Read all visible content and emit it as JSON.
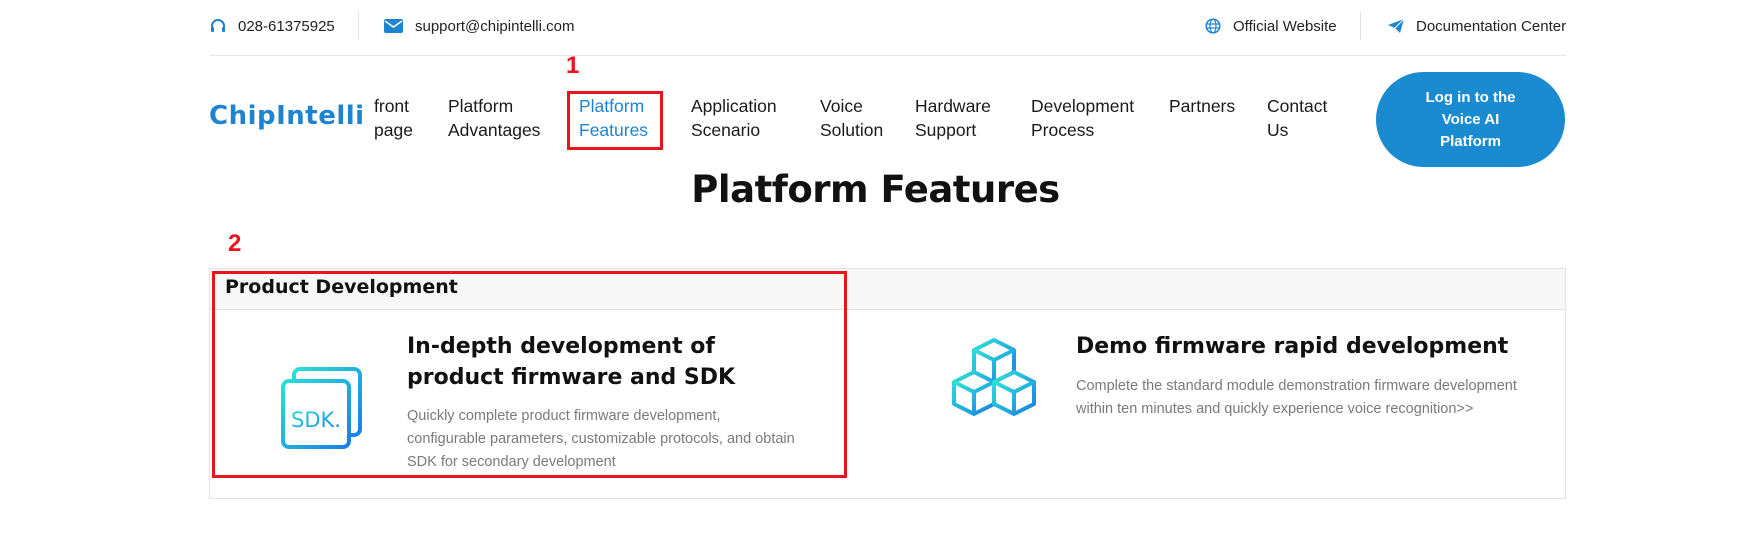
{
  "topbar": {
    "phone": "028-61375925",
    "email": "support@chipintelli.com",
    "official_website": "Official Website",
    "documentation_center": "Documentation Center"
  },
  "brand": {
    "logo_text": "ChipIntelli",
    "color": "#1c84d1"
  },
  "nav": {
    "items": [
      {
        "label": "front\npage"
      },
      {
        "label": "Platform\nAdvantages"
      },
      {
        "label": "Platform\nFeatures",
        "active": true
      },
      {
        "label": "Application\nScenario"
      },
      {
        "label": "Voice\nSolution"
      },
      {
        "label": "Hardware\nSupport"
      },
      {
        "label": "Development\nProcess"
      },
      {
        "label": "Partners"
      },
      {
        "label": "Contact\nUs"
      }
    ],
    "login_button": "Log in to the\nVoice AI\nPlatform",
    "login_color": "#1a8bd0"
  },
  "section": {
    "title": "Platform Features",
    "panel_title": "Product Development",
    "cards": [
      {
        "icon": "sdk-icon",
        "title": "In-depth development of product firmware and SDK",
        "description": "Quickly complete product firmware development, configurable parameters, customizable protocols, and obtain SDK for secondary development"
      },
      {
        "icon": "cubes-icon",
        "title": "Demo firmware rapid development",
        "description": "Complete the standard module demonstration firmware development within ten minutes and quickly experience voice recognition>>"
      }
    ]
  },
  "annotations": {
    "color": "#e8141e",
    "labels": [
      "1",
      "2"
    ]
  }
}
